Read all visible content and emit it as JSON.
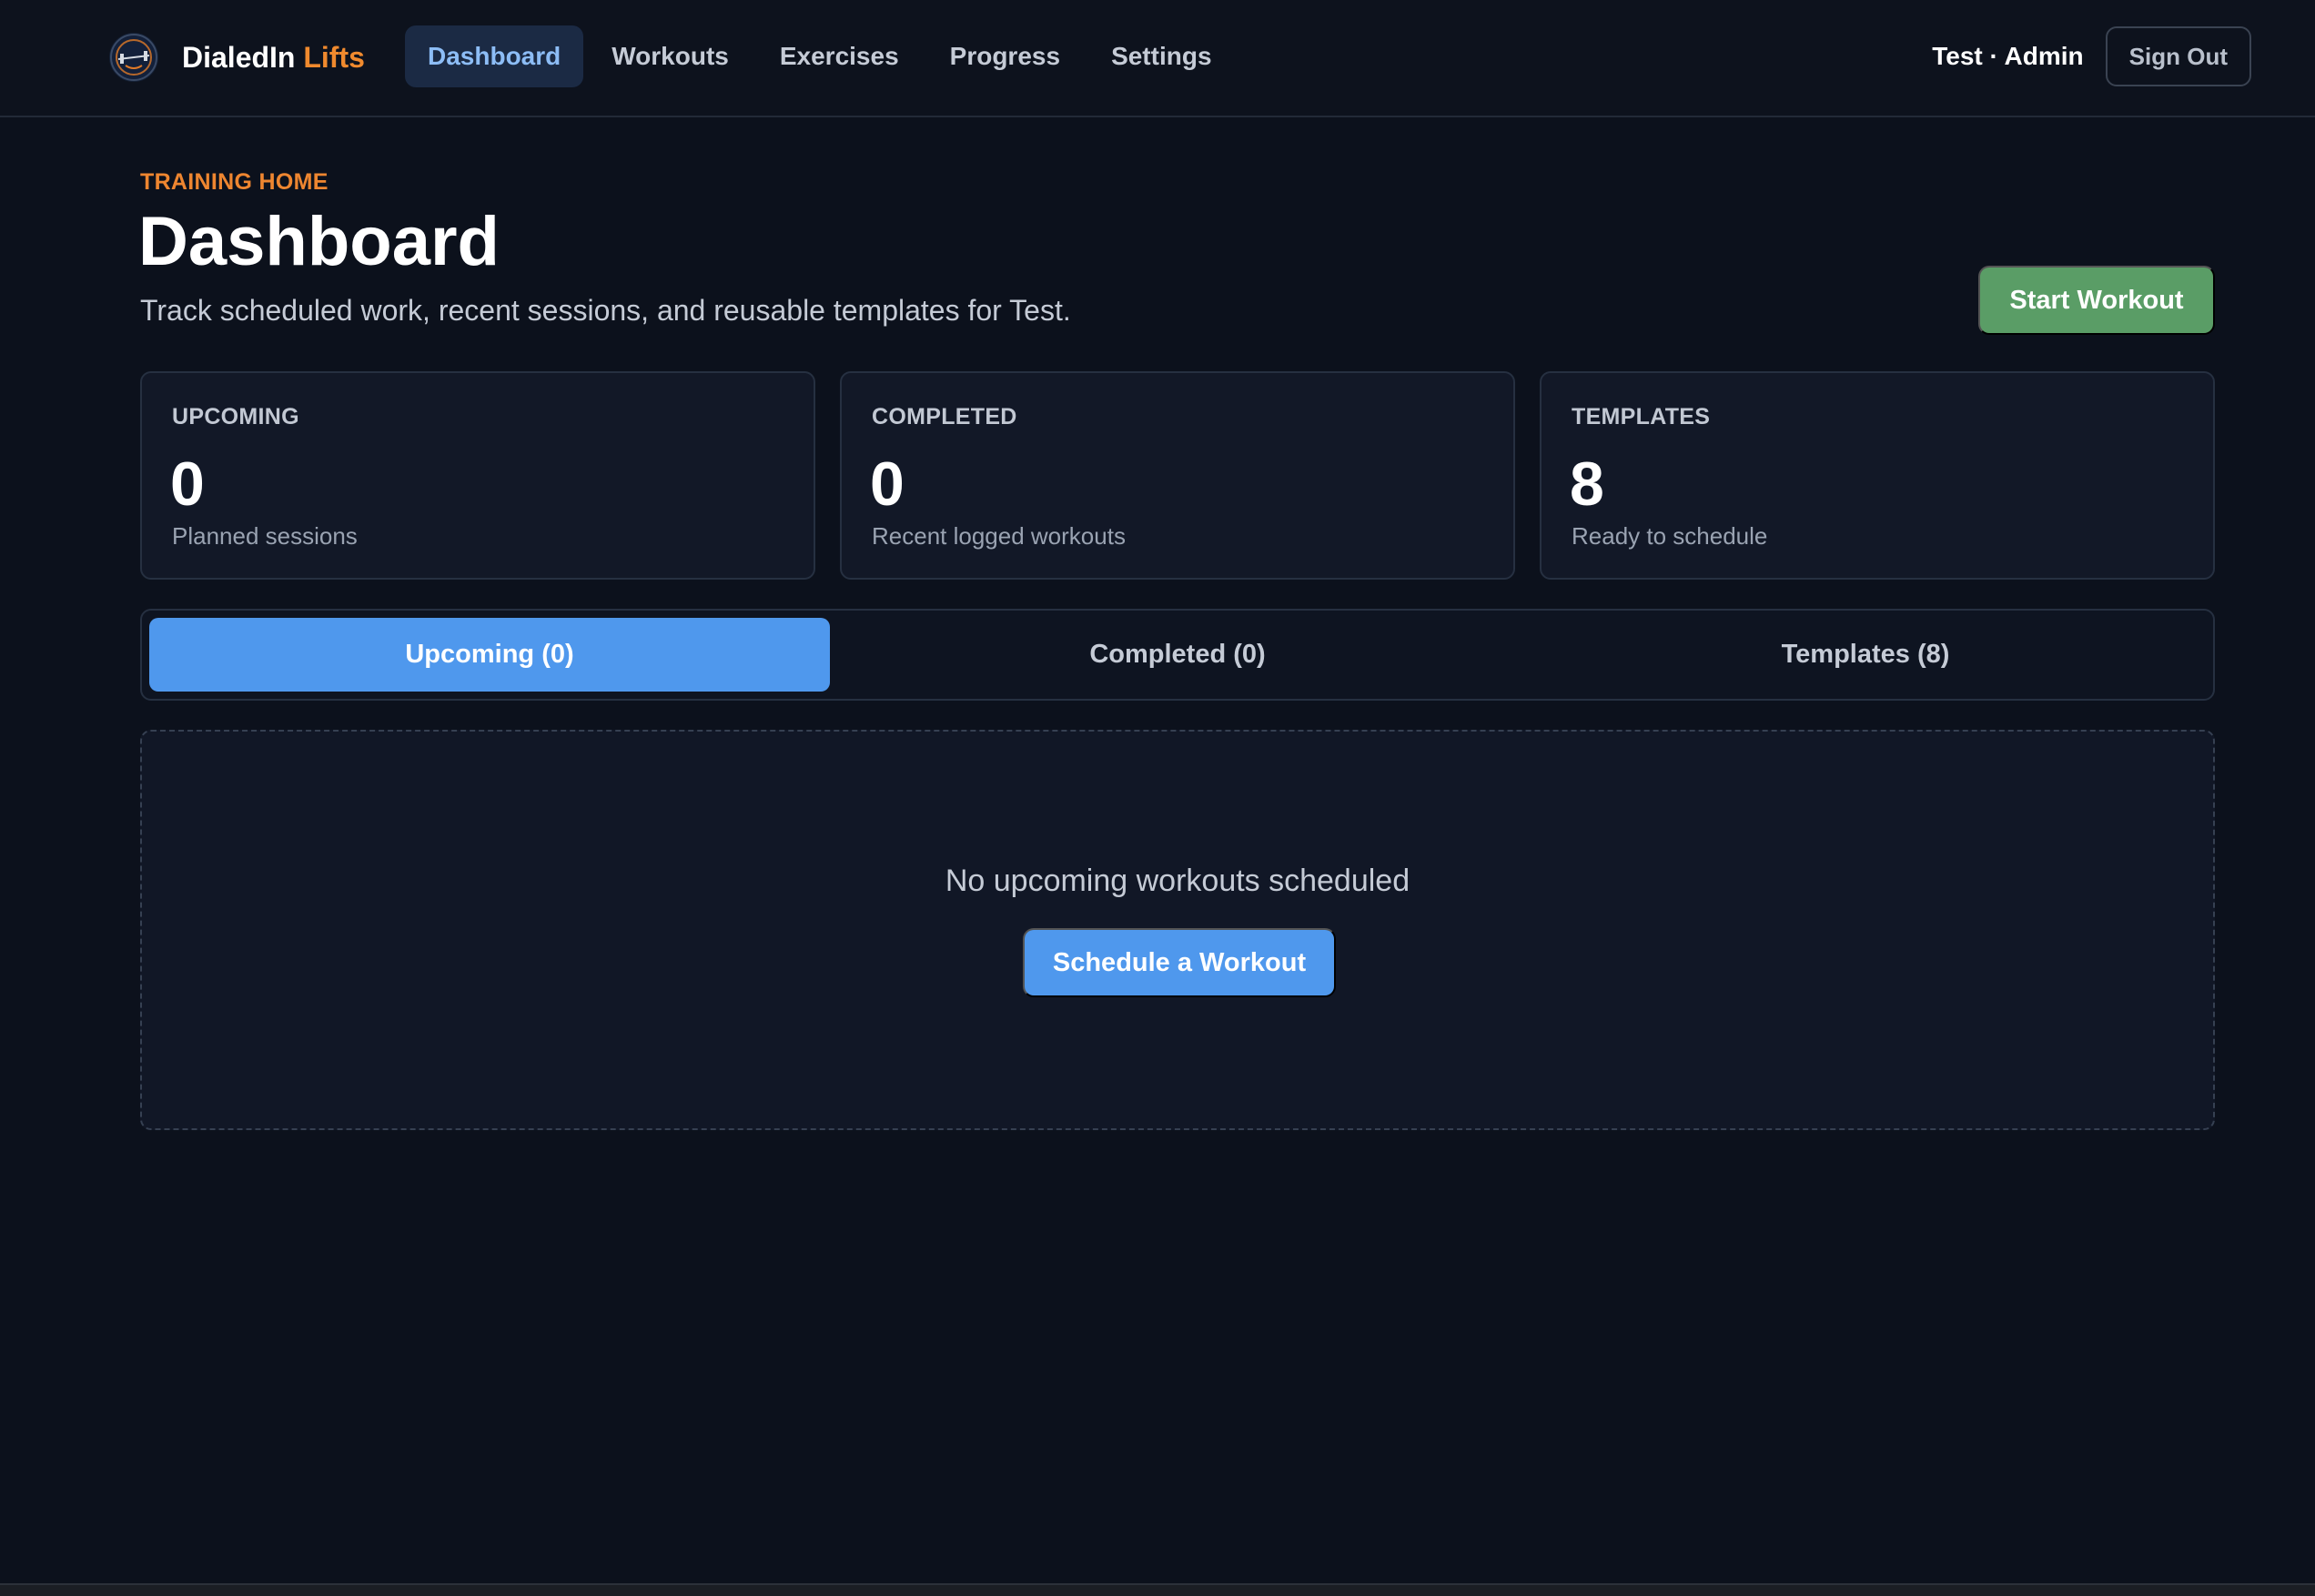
{
  "brand": {
    "name_main": "DialedIn",
    "name_accent": "Lifts",
    "logo_icon": "barbell-logo-icon"
  },
  "nav": {
    "items": [
      {
        "label": "Dashboard",
        "active": true
      },
      {
        "label": "Workouts",
        "active": false
      },
      {
        "label": "Exercises",
        "active": false
      },
      {
        "label": "Progress",
        "active": false
      },
      {
        "label": "Settings",
        "active": false
      }
    ]
  },
  "user": {
    "display": "Test · Admin",
    "sign_out_label": "Sign Out"
  },
  "header": {
    "eyebrow": "TRAINING HOME",
    "title": "Dashboard",
    "subtitle": "Track scheduled work, recent sessions, and reusable templates for Test.",
    "start_workout_label": "Start Workout"
  },
  "stats": [
    {
      "label": "UPCOMING",
      "value": "0",
      "caption": "Planned sessions"
    },
    {
      "label": "COMPLETED",
      "value": "0",
      "caption": "Recent logged workouts"
    },
    {
      "label": "TEMPLATES",
      "value": "8",
      "caption": "Ready to schedule"
    }
  ],
  "tabs": [
    {
      "label": "Upcoming (0)",
      "active": true
    },
    {
      "label": "Completed (0)",
      "active": false
    },
    {
      "label": "Templates (8)",
      "active": false
    }
  ],
  "empty_state": {
    "message": "No upcoming workouts scheduled",
    "action_label": "Schedule a Workout"
  },
  "colors": {
    "background": "#0c111c",
    "accent_orange": "#ee8630",
    "primary_blue": "#4f98ed",
    "success_green": "#5a9d66",
    "nav_active_bg": "#1b2a44",
    "nav_active_text": "#8dbdf6"
  }
}
